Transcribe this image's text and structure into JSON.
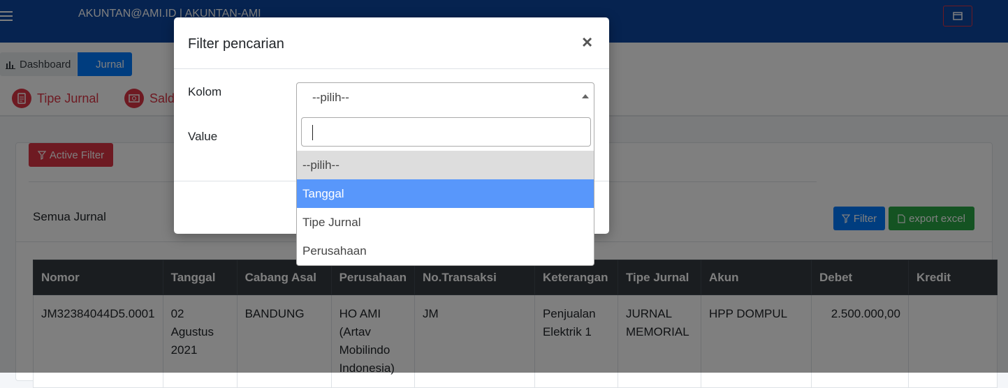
{
  "topbar": {
    "brand": "AKUNTAN@AMI.ID | AKUNTAN-AMI",
    "bg_color": "#0d47a1"
  },
  "breadcrumb": {
    "items": [
      "Dashboard",
      "Jurnal"
    ]
  },
  "tabs": [
    "Tipe Jurnal",
    "Saldo"
  ],
  "card": {
    "active_filter_label": "Active Filter",
    "title": "Semua Jurnal",
    "filter_label": "Filter",
    "export_label": "export excel"
  },
  "table": {
    "columns": [
      "Nomor",
      "Tanggal",
      "Cabang Asal",
      "Perusahaan",
      "No.Transaksi",
      "Keterangan",
      "Tipe Jurnal",
      "Akun",
      "Debet",
      "Kredit"
    ],
    "rows": [
      [
        "JM32384044D5.0001",
        "02 Agustus 2021",
        "BANDUNG",
        "HO AMI (Artav Mobilindo Indonesia)",
        "JM",
        "Penjualan Elektrik 1",
        "JURNAL MEMORIAL",
        "HPP DOMPUL",
        "2.500.000,00",
        ""
      ]
    ]
  },
  "modal": {
    "title": "Filter pencarian",
    "close": "×",
    "kolom_label": "Kolom",
    "value_label": "Value",
    "select_value": "--pilih--",
    "search_value": "",
    "options": [
      "--pilih--",
      "Tanggal",
      "Tipe Jurnal",
      "Perusahaan"
    ],
    "highlighted_option": "Tanggal"
  },
  "colors": {
    "danger": "#dc3545",
    "primary": "#007bff",
    "success": "#28a745",
    "highlight": "#5897fb"
  }
}
